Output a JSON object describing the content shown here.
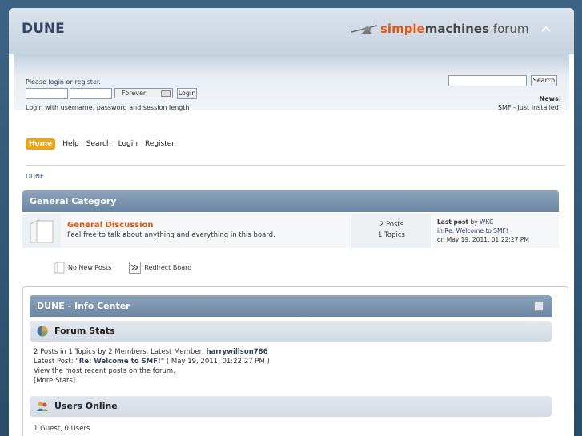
{
  "header": {
    "forum_title": "DUNE",
    "logo": {
      "simple": "simple",
      "machines": "machines",
      "forum": " forum"
    }
  },
  "userbar": {
    "login_hint_prefix": "Please ",
    "login_link": "login",
    "login_hint_mid": " or ",
    "register_link": "register",
    "login_hint_suffix": ".",
    "username_value": "",
    "password_value": "",
    "session_length": "Forever",
    "login_button": "Login",
    "login_note": "Login with username, password and session length",
    "search_value": "",
    "search_button": "Search",
    "news_label": "News:",
    "news_text": "SMF - Just Installed!"
  },
  "menu": {
    "items": [
      "Home",
      "Help",
      "Search",
      "Login",
      "Register"
    ]
  },
  "breadcrumb": "DUNE",
  "category": {
    "title": "General Category",
    "board": {
      "name": "General Discussion",
      "description": "Feel free to talk about anything and everything in this board.",
      "posts": "2 Posts",
      "topics": "1 Topics",
      "last_post_label": "Last post",
      "last_post_by": " by ",
      "last_post_user": "WKC",
      "last_post_in": "in ",
      "last_post_topic": "Re: Welcome to SMF!",
      "last_post_date": "on May 19, 2011, 01:22:27 PM"
    }
  },
  "legend": {
    "no_new": "No New Posts",
    "redirect": "Redirect Board"
  },
  "info_center": {
    "title": "DUNE - Info Center",
    "forum_stats": {
      "heading": "Forum Stats",
      "line1_prefix": "2 Posts in 1 Topics by 2 Members. Latest Member: ",
      "latest_member": "harrywillson786",
      "line2_prefix": "Latest Post: ",
      "latest_post": "\"Re: Welcome to SMF!\"",
      "line2_suffix": " ( May 19, 2011, 01:22:27 PM )",
      "recent_link": "View the most recent posts on the forum.",
      "more_stats": "[More Stats]"
    },
    "users_online": {
      "heading": "Users Online",
      "summary": "1 Guest, 0 Users"
    }
  },
  "colors": {
    "accent": "#f2a30d",
    "board_link": "#e8570c",
    "title_bar": "#7b93ae"
  }
}
